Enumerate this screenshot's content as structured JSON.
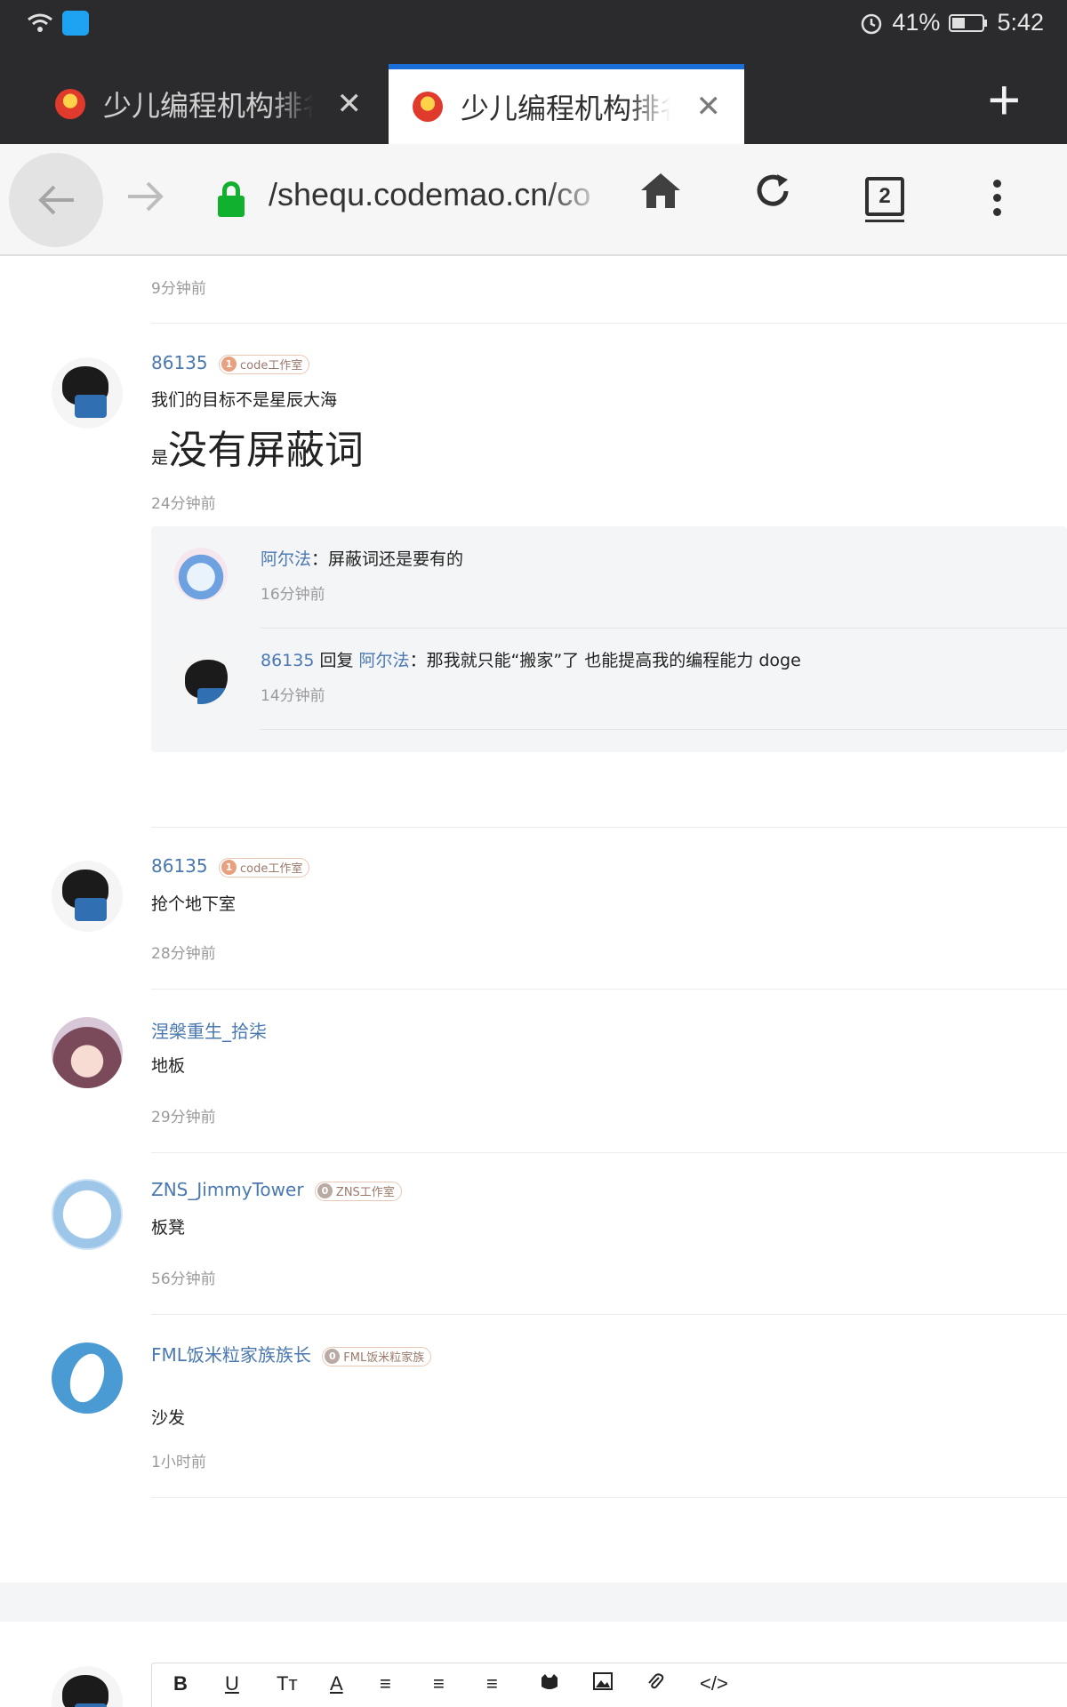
{
  "status": {
    "battery": "41%",
    "time": "5:42"
  },
  "tabs": [
    {
      "title": "少儿编程机构排名",
      "close": "✕",
      "active": false
    },
    {
      "title": "少儿编程机构排名",
      "close": "✕",
      "active": true
    }
  ],
  "new_tab": "+",
  "address": {
    "url": "/shequ.codemao.cn/co",
    "tab_count": "2"
  },
  "comments": {
    "c0": {
      "time": "9分钟前"
    },
    "c1": {
      "user": "86135",
      "badge_level": "1",
      "badge": "code工作室",
      "line1": "我们的目标不是星辰大海",
      "line2_small": "是",
      "line2_big": "没有屏蔽词",
      "time": "24分钟前",
      "replies": [
        {
          "user": "阿尔法",
          "sep": "：",
          "text": "屏蔽词还是要有的",
          "time": "16分钟前"
        },
        {
          "user": "86135",
          "reply_word": " 回复 ",
          "target": "阿尔法",
          "sep": "：",
          "text": "那我就只能“搬家”了 也能提高我的编程能力 doge",
          "time": "14分钟前"
        }
      ]
    },
    "c2": {
      "user": "86135",
      "badge_level": "1",
      "badge": "code工作室",
      "text": "抢个地下室",
      "time": "28分钟前"
    },
    "c3": {
      "user": "涅槃重生_拾柒",
      "text": "地板",
      "time": "29分钟前"
    },
    "c4": {
      "user": "ZNS_JimmyTower",
      "badge_level": "0",
      "badge": "ZNS工作室",
      "text": "板凳",
      "time": "56分钟前"
    },
    "c5": {
      "user": "FML饭米粒家族族长",
      "badge_level": "0",
      "badge": "FML饭米粒家族",
      "text": "沙发",
      "time": "1小时前"
    }
  },
  "editor": {
    "bold": "B",
    "underline": "U",
    "size": "Tт",
    "color": "A",
    "code": "</>"
  },
  "icons": [
    "wifi-icon",
    "alarm-icon",
    "battery-icon",
    "back-arrow-icon",
    "forward-arrow-icon",
    "lock-icon",
    "home-icon",
    "reload-icon",
    "kebab-menu-icon"
  ]
}
